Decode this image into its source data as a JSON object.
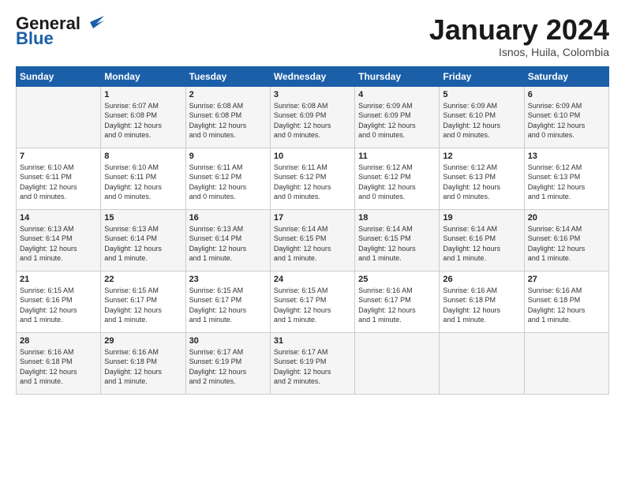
{
  "header": {
    "logo_general": "General",
    "logo_blue": "Blue",
    "month_title": "January 2024",
    "location": "Isnos, Huila, Colombia"
  },
  "weekdays": [
    "Sunday",
    "Monday",
    "Tuesday",
    "Wednesday",
    "Thursday",
    "Friday",
    "Saturday"
  ],
  "weeks": [
    [
      {
        "day": "",
        "info": ""
      },
      {
        "day": "1",
        "info": "Sunrise: 6:07 AM\nSunset: 6:08 PM\nDaylight: 12 hours\nand 0 minutes."
      },
      {
        "day": "2",
        "info": "Sunrise: 6:08 AM\nSunset: 6:08 PM\nDaylight: 12 hours\nand 0 minutes."
      },
      {
        "day": "3",
        "info": "Sunrise: 6:08 AM\nSunset: 6:09 PM\nDaylight: 12 hours\nand 0 minutes."
      },
      {
        "day": "4",
        "info": "Sunrise: 6:09 AM\nSunset: 6:09 PM\nDaylight: 12 hours\nand 0 minutes."
      },
      {
        "day": "5",
        "info": "Sunrise: 6:09 AM\nSunset: 6:10 PM\nDaylight: 12 hours\nand 0 minutes."
      },
      {
        "day": "6",
        "info": "Sunrise: 6:09 AM\nSunset: 6:10 PM\nDaylight: 12 hours\nand 0 minutes."
      }
    ],
    [
      {
        "day": "7",
        "info": "Sunrise: 6:10 AM\nSunset: 6:11 PM\nDaylight: 12 hours\nand 0 minutes."
      },
      {
        "day": "8",
        "info": "Sunrise: 6:10 AM\nSunset: 6:11 PM\nDaylight: 12 hours\nand 0 minutes."
      },
      {
        "day": "9",
        "info": "Sunrise: 6:11 AM\nSunset: 6:12 PM\nDaylight: 12 hours\nand 0 minutes."
      },
      {
        "day": "10",
        "info": "Sunrise: 6:11 AM\nSunset: 6:12 PM\nDaylight: 12 hours\nand 0 minutes."
      },
      {
        "day": "11",
        "info": "Sunrise: 6:12 AM\nSunset: 6:12 PM\nDaylight: 12 hours\nand 0 minutes."
      },
      {
        "day": "12",
        "info": "Sunrise: 6:12 AM\nSunset: 6:13 PM\nDaylight: 12 hours\nand 0 minutes."
      },
      {
        "day": "13",
        "info": "Sunrise: 6:12 AM\nSunset: 6:13 PM\nDaylight: 12 hours\nand 1 minute."
      }
    ],
    [
      {
        "day": "14",
        "info": "Sunrise: 6:13 AM\nSunset: 6:14 PM\nDaylight: 12 hours\nand 1 minute."
      },
      {
        "day": "15",
        "info": "Sunrise: 6:13 AM\nSunset: 6:14 PM\nDaylight: 12 hours\nand 1 minute."
      },
      {
        "day": "16",
        "info": "Sunrise: 6:13 AM\nSunset: 6:14 PM\nDaylight: 12 hours\nand 1 minute."
      },
      {
        "day": "17",
        "info": "Sunrise: 6:14 AM\nSunset: 6:15 PM\nDaylight: 12 hours\nand 1 minute."
      },
      {
        "day": "18",
        "info": "Sunrise: 6:14 AM\nSunset: 6:15 PM\nDaylight: 12 hours\nand 1 minute."
      },
      {
        "day": "19",
        "info": "Sunrise: 6:14 AM\nSunset: 6:16 PM\nDaylight: 12 hours\nand 1 minute."
      },
      {
        "day": "20",
        "info": "Sunrise: 6:14 AM\nSunset: 6:16 PM\nDaylight: 12 hours\nand 1 minute."
      }
    ],
    [
      {
        "day": "21",
        "info": "Sunrise: 6:15 AM\nSunset: 6:16 PM\nDaylight: 12 hours\nand 1 minute."
      },
      {
        "day": "22",
        "info": "Sunrise: 6:15 AM\nSunset: 6:17 PM\nDaylight: 12 hours\nand 1 minute."
      },
      {
        "day": "23",
        "info": "Sunrise: 6:15 AM\nSunset: 6:17 PM\nDaylight: 12 hours\nand 1 minute."
      },
      {
        "day": "24",
        "info": "Sunrise: 6:15 AM\nSunset: 6:17 PM\nDaylight: 12 hours\nand 1 minute."
      },
      {
        "day": "25",
        "info": "Sunrise: 6:16 AM\nSunset: 6:17 PM\nDaylight: 12 hours\nand 1 minute."
      },
      {
        "day": "26",
        "info": "Sunrise: 6:16 AM\nSunset: 6:18 PM\nDaylight: 12 hours\nand 1 minute."
      },
      {
        "day": "27",
        "info": "Sunrise: 6:16 AM\nSunset: 6:18 PM\nDaylight: 12 hours\nand 1 minute."
      }
    ],
    [
      {
        "day": "28",
        "info": "Sunrise: 6:16 AM\nSunset: 6:18 PM\nDaylight: 12 hours\nand 1 minute."
      },
      {
        "day": "29",
        "info": "Sunrise: 6:16 AM\nSunset: 6:18 PM\nDaylight: 12 hours\nand 1 minute."
      },
      {
        "day": "30",
        "info": "Sunrise: 6:17 AM\nSunset: 6:19 PM\nDaylight: 12 hours\nand 2 minutes."
      },
      {
        "day": "31",
        "info": "Sunrise: 6:17 AM\nSunset: 6:19 PM\nDaylight: 12 hours\nand 2 minutes."
      },
      {
        "day": "",
        "info": ""
      },
      {
        "day": "",
        "info": ""
      },
      {
        "day": "",
        "info": ""
      }
    ]
  ]
}
